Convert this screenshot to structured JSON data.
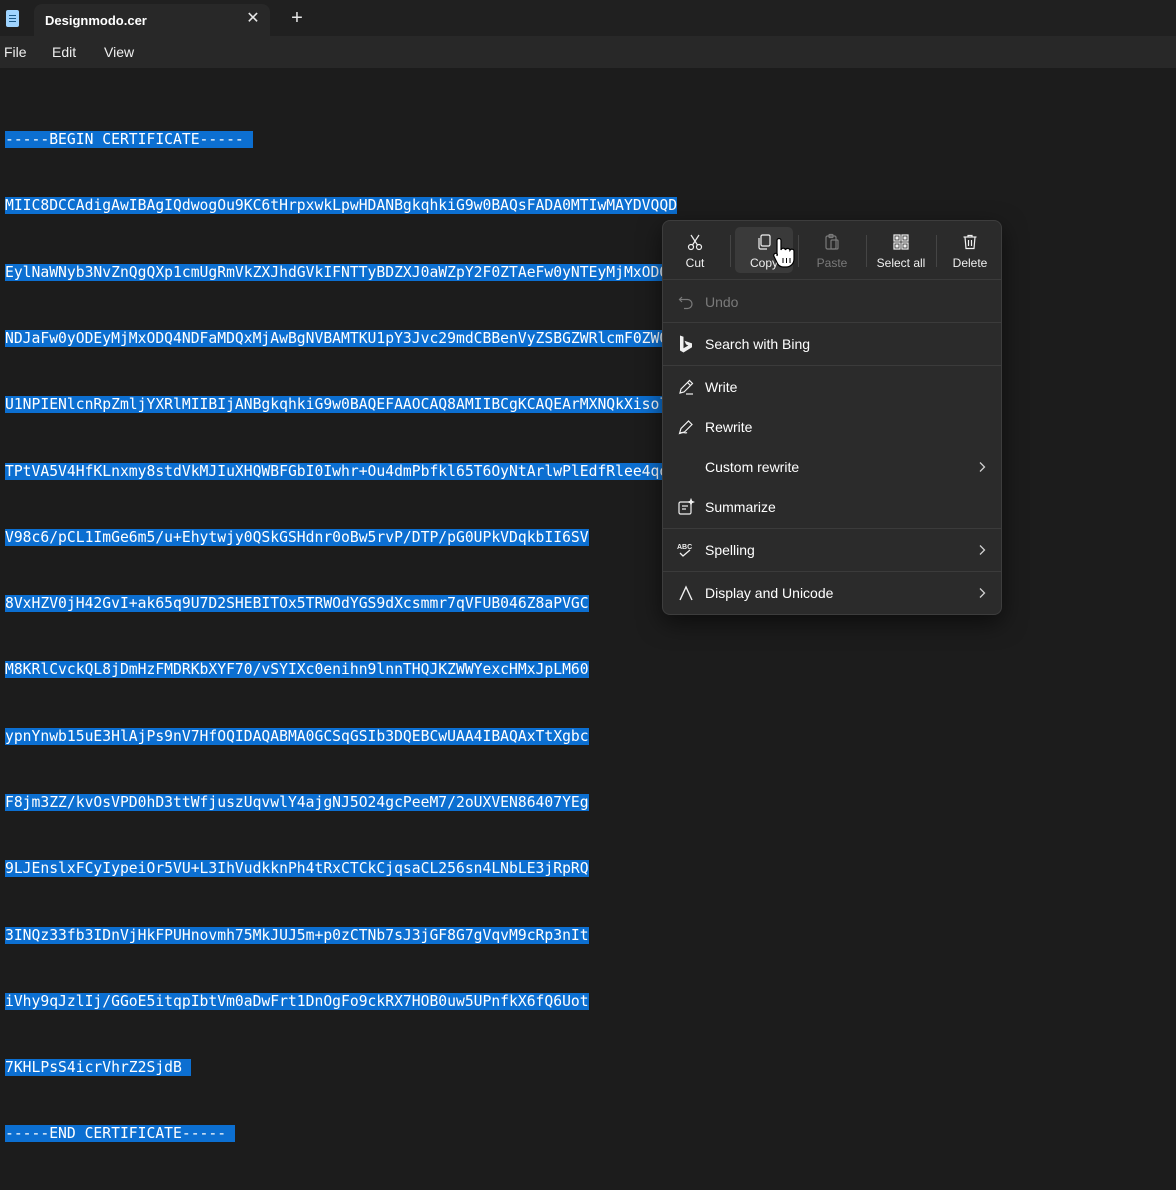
{
  "window": {
    "tab_title": "Designmodo.cer",
    "close_tab_glyph": "✕",
    "new_tab_glyph": "+"
  },
  "menubar": {
    "items": [
      "File",
      "Edit",
      "View"
    ]
  },
  "document": {
    "lines": [
      "-----BEGIN CERTIFICATE-----",
      "MIIC8DCCAdigAwIBAgIQdwogOu9KC6tHrpxwkLpwHDANBgkqhkiG9w0BAQsFADA0MTIwMAYDVQQD",
      "EylNaWNyb3NvZnQgQXp1cmUgRmVkZXJhdGVkIFNTTyBDZXJ0aWZpY2F0ZTAeFw0yNTEyMjMxODQ4",
      "NDJaFw0yODEyMjMxODQ4NDFaMDQxMjAwBgNVBAMTKU1pY3Jvc29mdCBBenVyZSBGZWRlcmF0ZWQg",
      "U1NPIENlcnRpZmljYXRlMIIBIjANBgkqhkiG9w0BAQEFAAOCAQ8AMIIBCgKCAQEArMXNQkXisolv",
      "TPtVA5V4HfKLnxmy8stdVkMJIuXHQWBFGbI0Iwhr+Ou4dmPbfkl65T6OyNtArlwPlEdfRlee4qok",
      "V98c6/pCL1ImGe6m5/u+Ehytwjy0QSkGSHdnr0oBw5rvP/DTP/pG0UPkVDqkbII6SV",
      "8VxHZV0jH42GvI+ak65q9U7D2SHEBITOx5TRWOdYGS9dXcsmmr7qVFUB046Z8aPVGC",
      "M8KRlCvckQL8jDmHzFMDRKbXYF70/vSYIXc0enihn9lnnTHQJKZWWYexcHMxJpLM60",
      "ypnYnwb15uE3HlAjPs9nV7HfOQIDAQABMA0GCSqGSIb3DQEBCwUAA4IBAQAxTtXgbc",
      "F8jm3ZZ/kvOsVPD0hD3ttWfjuszUqvwlY4ajgNJ5O24gcPeeM7/2oUXVEN86407YEg",
      "9LJEnslxFCyIypeiOr5VU+L3IhVudkknPh4tRxCTCkCjqsaCL256sn4LNbLE3jRpRQ",
      "3INQz33fb3IDnVjHkFPUHnovmh75MkJUJ5m+p0zCTNb7sJ3jGF8G7gVqvM9cRp3nIt",
      "iVhy9qJzlIj/GGoE5itqpIbtVm0aDwFrt1DnOgFo9ckRX7HOB0uw5UPnfkX6fQ6Uot",
      "7KHLPsS4icrVhrZ2SjdB",
      "-----END CERTIFICATE-----"
    ]
  },
  "context_menu": {
    "quick_actions": [
      {
        "label": "Cut",
        "icon": "scissors-icon",
        "enabled": true
      },
      {
        "label": "Copy",
        "icon": "copy-icon",
        "enabled": true
      },
      {
        "label": "Paste",
        "icon": "paste-icon",
        "enabled": false
      },
      {
        "label": "Select all",
        "icon": "select-all-icon",
        "enabled": true
      },
      {
        "label": "Delete",
        "icon": "trash-icon",
        "enabled": true
      }
    ],
    "items": [
      {
        "label": "Undo",
        "icon": "undo-icon",
        "enabled": false
      },
      {
        "label": "Search with Bing",
        "icon": "bing-icon"
      },
      {
        "label": "Write",
        "icon": "pencil-icon"
      },
      {
        "label": "Rewrite",
        "icon": "pen-icon"
      },
      {
        "label": "Custom rewrite",
        "icon": "",
        "submenu": true
      },
      {
        "label": "Summarize",
        "icon": "summarize-icon"
      },
      {
        "label": "Spelling",
        "icon": "spelling-icon",
        "submenu": true
      },
      {
        "label": "Display and Unicode",
        "icon": "lambda-icon",
        "submenu": true
      }
    ]
  },
  "colors": {
    "selection": "#0c6fd1",
    "background": "#1c1c1c",
    "menu": "#2b2b2b"
  }
}
